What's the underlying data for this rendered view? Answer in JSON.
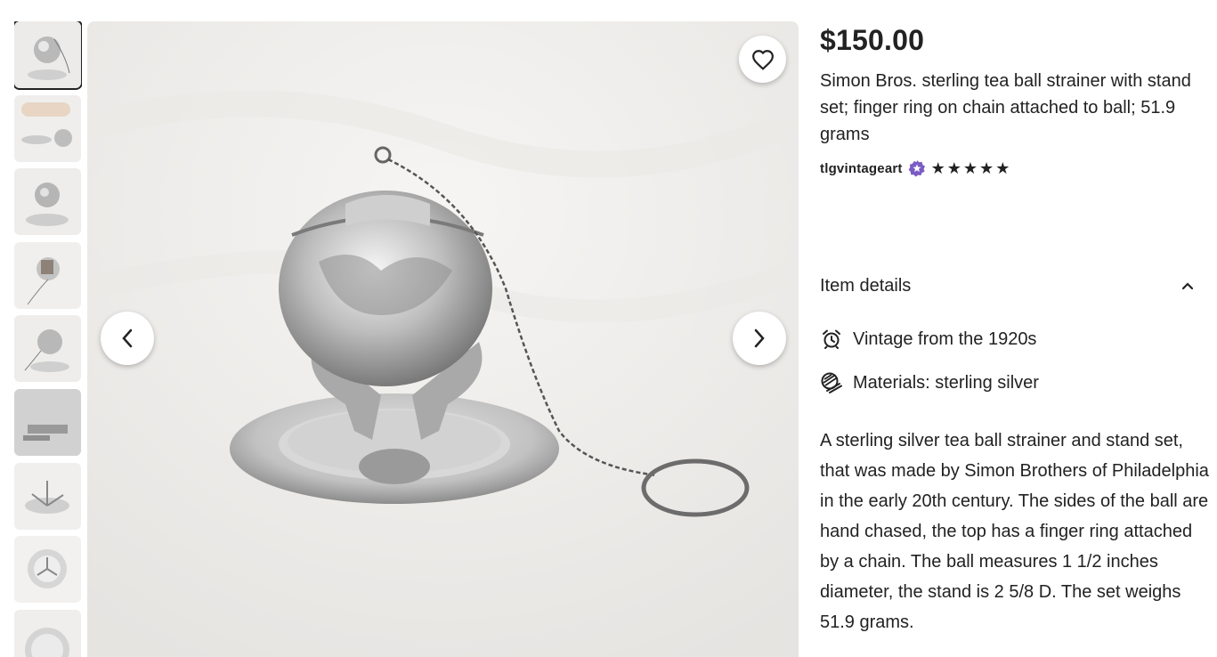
{
  "listing": {
    "price": "$150.00",
    "title": "Simon Bros. sterling tea ball strainer with stand set; finger ring on chain attached to ball; 51.9 grams",
    "seller": "tlgvintageart",
    "rating_stars": 5
  },
  "gallery": {
    "thumbnail_count": 9,
    "active_index": 0,
    "icons": {
      "favorite": "heart-icon",
      "prev": "chevron-left-icon",
      "next": "chevron-right-icon"
    }
  },
  "item_details": {
    "header": "Item details",
    "vintage": "Vintage from the 1920s",
    "materials": "Materials: sterling silver",
    "description": "A sterling silver tea ball strainer and stand set, that was made by Simon Brothers of Philadelphia in the early 20th century. The sides of the ball are hand chased, the top has a finger ring attached by a chain. The ball measures 1 1/2 inches diameter, the stand is 2 5/8 D. The set weighs 51.9 grams."
  },
  "colors": {
    "text": "#222222",
    "star_seller_badge": "#7b5cc4",
    "background": "#ffffff"
  }
}
